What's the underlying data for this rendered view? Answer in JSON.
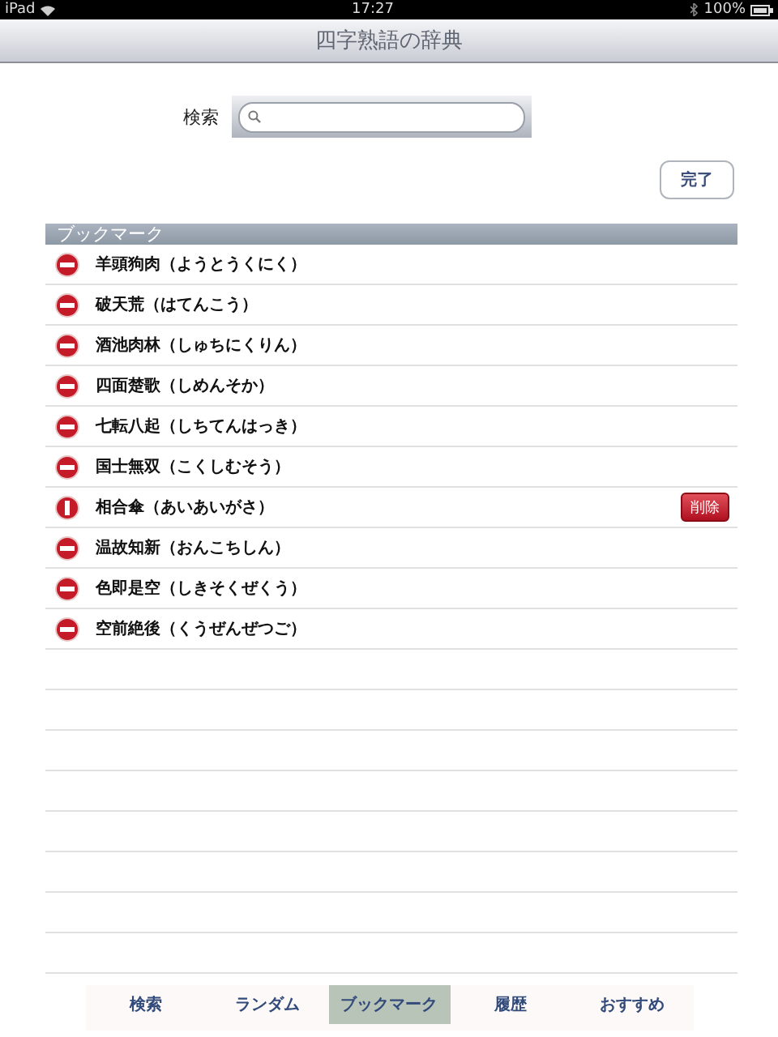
{
  "status_bar": {
    "device": "iPad",
    "time": "17:27",
    "battery": "100%"
  },
  "nav_bar": {
    "title": "四字熟語の辞典"
  },
  "search": {
    "label": "検索"
  },
  "done_button": "完了",
  "section_header": "ブックマーク",
  "delete_button": "削除",
  "rows": [
    {
      "label": "羊頭狗肉（ようとうくにく）",
      "confirming": false
    },
    {
      "label": "破天荒（はてんこう）",
      "confirming": false
    },
    {
      "label": "酒池肉林（しゅちにくりん）",
      "confirming": false
    },
    {
      "label": "四面楚歌（しめんそか）",
      "confirming": false
    },
    {
      "label": "七転八起（しちてんはっき）",
      "confirming": false
    },
    {
      "label": "国士無双（こくしむそう）",
      "confirming": false
    },
    {
      "label": "相合傘（あいあいがさ）",
      "confirming": true
    },
    {
      "label": "温故知新（おんこちしん）",
      "confirming": false
    },
    {
      "label": "色即是空（しきそくぜくう）",
      "confirming": false
    },
    {
      "label": "空前絶後（くうぜんぜつご）",
      "confirming": false
    }
  ],
  "tabs": [
    {
      "label": "検索",
      "selected": false
    },
    {
      "label": "ランダム",
      "selected": false
    },
    {
      "label": "ブックマーク",
      "selected": true
    },
    {
      "label": "履歴",
      "selected": false
    },
    {
      "label": "おすすめ",
      "selected": false
    }
  ]
}
